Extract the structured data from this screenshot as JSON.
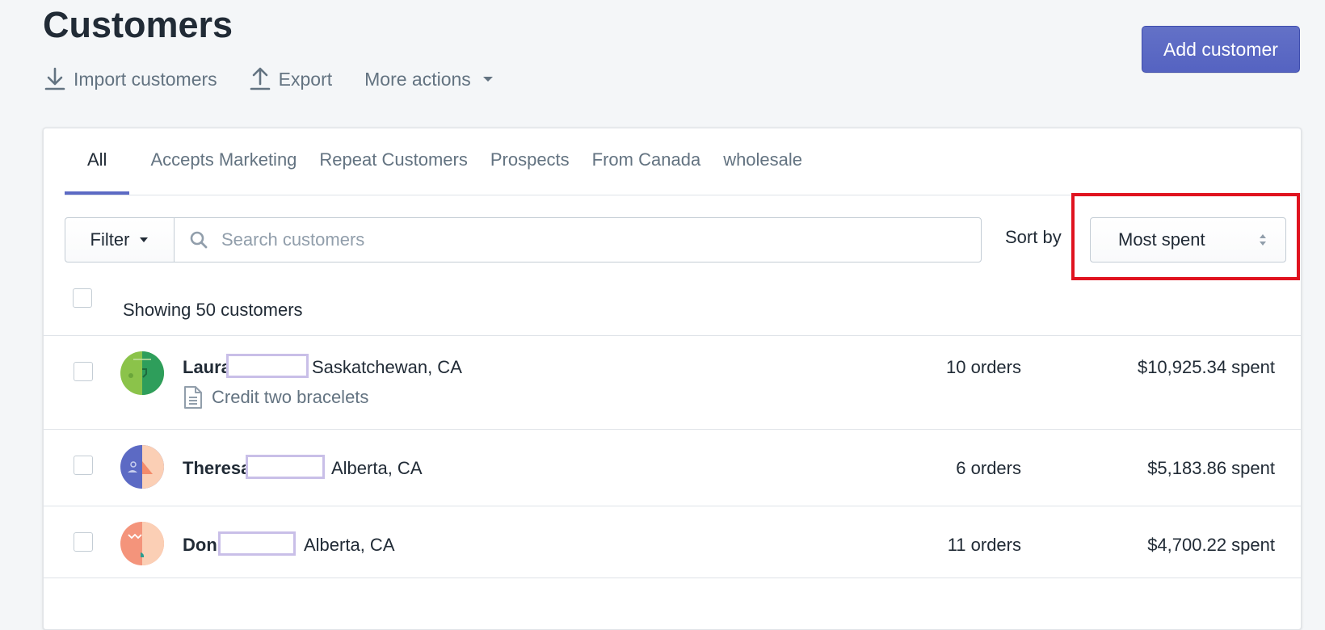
{
  "header": {
    "title": "Customers"
  },
  "actions": {
    "import_label": "Import customers",
    "export_label": "Export",
    "more_label": "More actions"
  },
  "primary": {
    "add_label": "Add customer"
  },
  "tabs": [
    {
      "label": "All",
      "active": true
    },
    {
      "label": "Accepts Marketing"
    },
    {
      "label": "Repeat Customers"
    },
    {
      "label": "Prospects"
    },
    {
      "label": "From Canada"
    },
    {
      "label": "wholesale"
    }
  ],
  "filter": {
    "label": "Filter"
  },
  "search": {
    "placeholder": "Search customers"
  },
  "sort": {
    "label": "Sort by",
    "value": "Most spent"
  },
  "list": {
    "showing": "Showing 50 customers",
    "customers": [
      {
        "name": "Laura",
        "location": "Saskatchewan, CA",
        "orders": "10 orders",
        "spent": "$10,925.34 spent",
        "note": "Credit two bracelets"
      },
      {
        "name": "Theresa",
        "location": "Alberta, CA",
        "orders": "6 orders",
        "spent": "$5,183.86 spent"
      },
      {
        "name": "Don",
        "location": "Alberta, CA",
        "orders": "11 orders",
        "spent": "$4,700.22 spent"
      }
    ]
  },
  "colors": {
    "accent": "#5c6ac4",
    "highlight": "#e0131f",
    "redaction": "#c9bfe8"
  }
}
